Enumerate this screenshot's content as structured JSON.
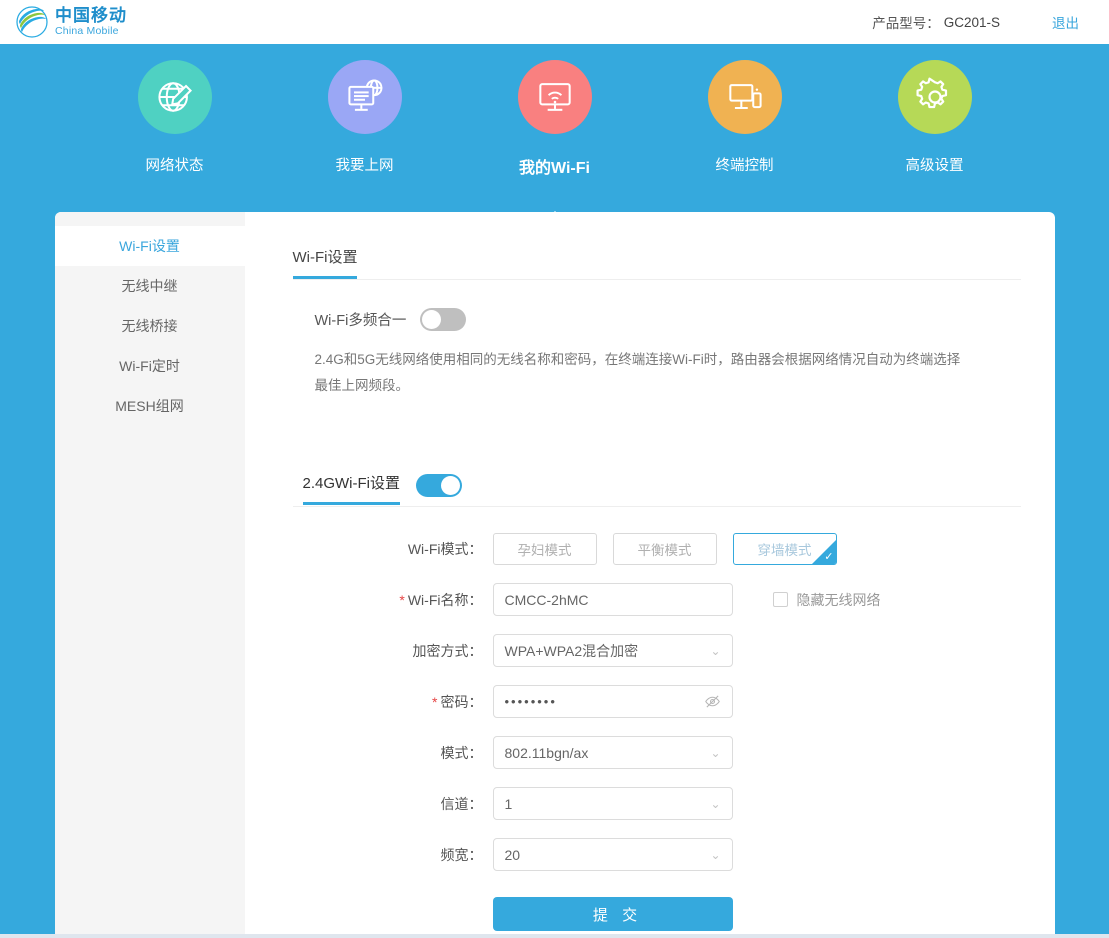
{
  "header": {
    "brand_cn": "中国移动",
    "brand_en": "China Mobile",
    "model_label": "产品型号：",
    "model_value": "GC201-S",
    "logout": "退出",
    "brand_color": "#1f8ecb"
  },
  "nav": {
    "accent": "#35a9dd",
    "items": [
      {
        "label": "网络状态",
        "icon": "globe-pencil-icon",
        "color": "#4fd1c2",
        "active": false
      },
      {
        "label": "我要上网",
        "icon": "monitor-globe-icon",
        "color": "#9aa7f5",
        "active": false
      },
      {
        "label": "我的Wi-Fi",
        "icon": "monitor-wifi-icon",
        "color": "#f98080",
        "active": true
      },
      {
        "label": "终端控制",
        "icon": "monitor-phone-icon",
        "color": "#f0b252",
        "active": false
      },
      {
        "label": "高级设置",
        "icon": "gear-icon",
        "color": "#b6d957",
        "active": false
      }
    ]
  },
  "sidebar": {
    "items": [
      {
        "label": "Wi-Fi设置",
        "active": true
      },
      {
        "label": "无线中继",
        "active": false
      },
      {
        "label": "无线桥接",
        "active": false
      },
      {
        "label": "Wi-Fi定时",
        "active": false
      },
      {
        "label": "MESH组网",
        "active": false
      }
    ]
  },
  "content": {
    "tab_label": "Wi-Fi设置",
    "multiband": {
      "label": "Wi-Fi多频合一",
      "enabled": false,
      "description": "2.4G和5G无线网络使用相同的无线名称和密码，在终端连接Wi-Fi时，路由器会根据网络情况自动为终端选择最佳上网频段。"
    },
    "band24": {
      "title": "2.4GWi-Fi设置",
      "enabled": true,
      "mode": {
        "label": "Wi-Fi模式：",
        "options": [
          "孕妇模式",
          "平衡模式",
          "穿墙模式"
        ],
        "selected": "穿墙模式"
      },
      "ssid": {
        "label": "Wi-Fi名称：",
        "required": true,
        "value": "CMCC-2hMC",
        "hide_network_label": "隐藏无线网络",
        "hide_network_checked": false
      },
      "encryption": {
        "label": "加密方式：",
        "value": "WPA+WPA2混合加密"
      },
      "password": {
        "label": "密码：",
        "required": true,
        "value": "••••••••",
        "toggle_icon": "eye-off-icon"
      },
      "phy_mode": {
        "label": "模式：",
        "value": "802.11bgn/ax"
      },
      "channel": {
        "label": "信道：",
        "value": "1"
      },
      "bandwidth": {
        "label": "频宽：",
        "value": "20"
      },
      "submit_label": "提 交"
    }
  }
}
